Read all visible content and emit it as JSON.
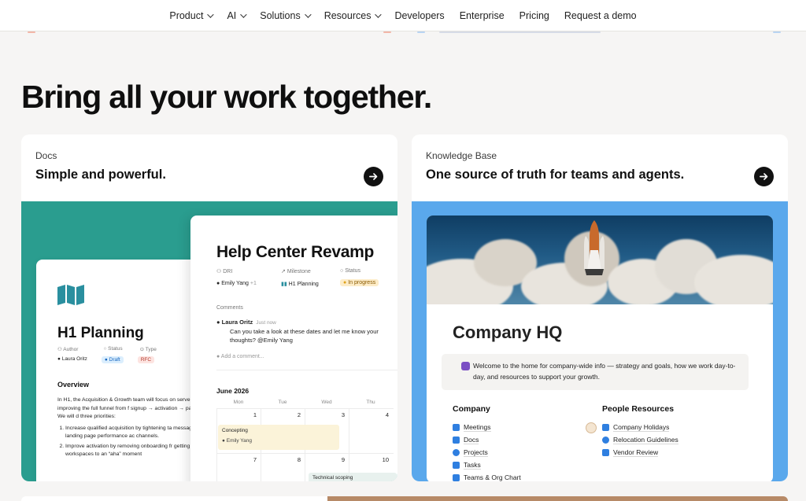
{
  "nav": {
    "items": [
      {
        "label": "Product",
        "dropdown": true
      },
      {
        "label": "AI",
        "dropdown": true
      },
      {
        "label": "Solutions",
        "dropdown": true
      },
      {
        "label": "Resources",
        "dropdown": true
      },
      {
        "label": "Developers",
        "dropdown": false
      },
      {
        "label": "Enterprise",
        "dropdown": false
      },
      {
        "label": "Pricing",
        "dropdown": false
      },
      {
        "label": "Request a demo",
        "dropdown": false
      }
    ]
  },
  "headline": "Bring all your work together.",
  "cards": [
    {
      "eyebrow": "Docs",
      "title": "Simple and powerful.",
      "bg_color": "#2a9d8f",
      "h1_doc": {
        "title": "H1 Planning",
        "props": {
          "author_label": "Author",
          "status_label": "Status",
          "type_label": "Type",
          "author": "Laura Oritz",
          "status": "Draft",
          "type": "RFC"
        },
        "overview_heading": "Overview",
        "overview_text": "In H1, the Acquisition & Growth team will focus on serve revenue by improving the full funnel from f signup → activation → paid conversion. We will d three priorities:",
        "bullets": [
          "Increase qualified acquisition by tightening ta messaging, and landing page performance ac channels.",
          "Improve activation by removing onboarding fr getting new workspaces to an “aha” moment"
        ]
      },
      "help_doc": {
        "title": "Help Center Revamp",
        "dri_label": "DRI",
        "milestone_label": "Milestone",
        "status_label": "Status",
        "dri": "Emily Yang",
        "dri_extra": "+1",
        "milestone": "H1 Planning",
        "status": "In progress",
        "comments_label": "Comments",
        "comment_author": "Laura Oritz",
        "comment_time": "Just now",
        "comment_text": "Can you take a look at these dates and let me know your thoughts? @Emily Yang",
        "add_comment_placeholder": "Add a comment...",
        "calendar_title": "June 2026",
        "days": [
          "Mon",
          "Tue",
          "Wed",
          "Thu"
        ],
        "row1": [
          "1",
          "2",
          "3",
          "4"
        ],
        "row2": [
          "7",
          "8",
          "9",
          "10"
        ],
        "event1": {
          "title": "Concepting",
          "person": "Emily Yang"
        },
        "event2": {
          "title": "Technical scoping"
        }
      }
    },
    {
      "eyebrow": "Knowledge Base",
      "title": "One source of truth for teams and agents.",
      "bg_color": "#5aa8ec",
      "kb": {
        "title": "Company HQ",
        "callout": "Welcome to the home for company-wide info — strategy and goals, how we work day-to-day, and resources to support your growth.",
        "company_heading": "Company",
        "company_links": [
          "Meetings",
          "Docs",
          "Projects",
          "Tasks",
          "Teams & Org Chart"
        ],
        "people_heading": "People Resources",
        "people_links": [
          "Company Holidays",
          "Relocation Guidelines",
          "Vendor Review"
        ]
      }
    }
  ]
}
